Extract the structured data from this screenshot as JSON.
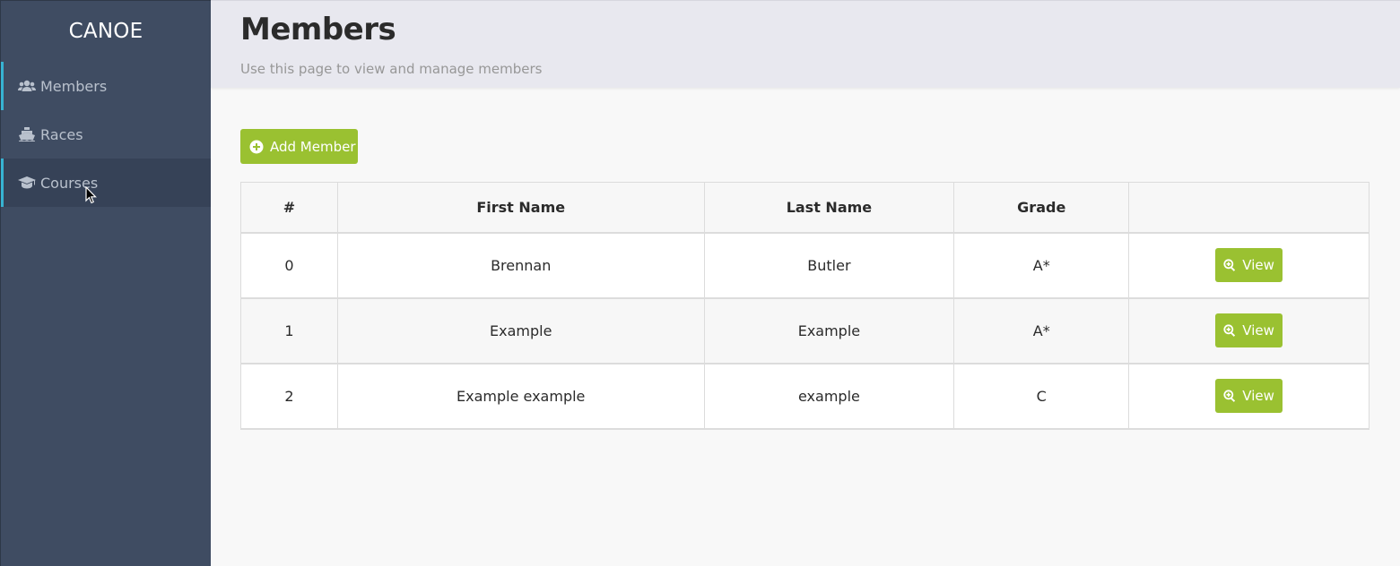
{
  "sidebar": {
    "brand": "CANOE",
    "items": [
      {
        "label": "Members",
        "icon": "users-icon"
      },
      {
        "label": "Races",
        "icon": "ship-icon"
      },
      {
        "label": "Courses",
        "icon": "graduation-cap-icon"
      }
    ]
  },
  "header": {
    "title": "Members",
    "subtitle": "Use this page to view and manage members"
  },
  "toolbar": {
    "add_label": "Add Member",
    "add_icon": "plus-circle-icon"
  },
  "table": {
    "columns": [
      "#",
      "First Name",
      "Last Name",
      "Grade",
      ""
    ],
    "rows": [
      {
        "id": "0",
        "first": "Brennan",
        "last": "Butler",
        "grade": "A*",
        "action": "View"
      },
      {
        "id": "1",
        "first": "Example",
        "last": "Example",
        "grade": "A*",
        "action": "View"
      },
      {
        "id": "2",
        "first": "Example example",
        "last": "example",
        "grade": "C",
        "action": "View"
      }
    ]
  },
  "colors": {
    "sidebar_bg": "#3f4c62",
    "accent": "#37b3d2",
    "button_green": "#9ac131",
    "header_bg": "#e8e8ef"
  }
}
